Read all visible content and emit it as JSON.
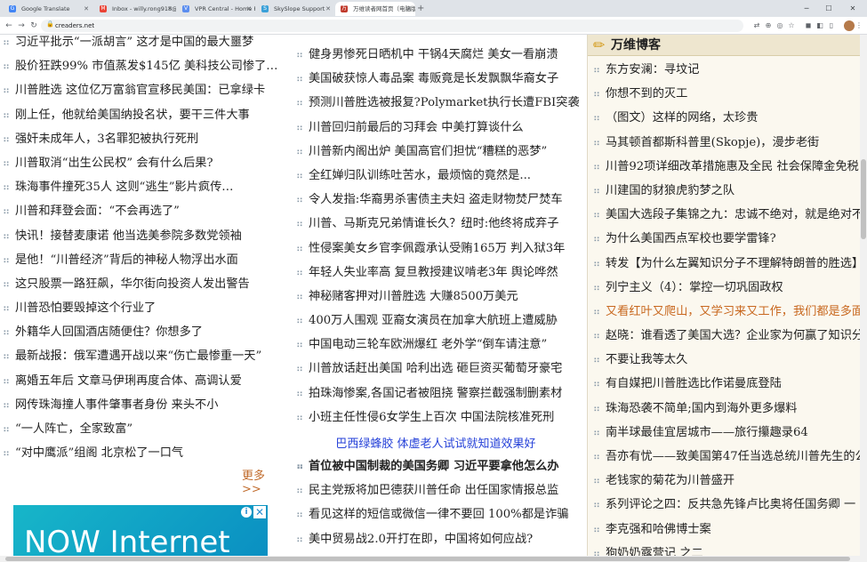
{
  "browser": {
    "tabs": [
      {
        "title": "Google Translate",
        "icon": "translate-icon",
        "color": "#4285f4"
      },
      {
        "title": "Inbox - willy.rong918@gmail.c...",
        "icon": "gmail-icon",
        "color": "#ea4335"
      },
      {
        "title": "VPR Central - Home Page",
        "icon": "page-icon",
        "color": "#5b8def"
      },
      {
        "title": "SkySlope Support",
        "icon": "support-icon",
        "color": "#3aa0d8"
      },
      {
        "title": "万维读者网首页（电脑版）",
        "icon": "site-icon",
        "color": "#c0392b"
      }
    ],
    "url": "creaders.net"
  },
  "left_column": {
    "headlines": [
      "习近平批示“一派胡言” 这才是中国的最大噩梦",
      "股价狂跌99% 市值蒸发$145亿 美科技公司惨了…",
      "川普胜选 这位亿万富翁官宣移民美国：已拿绿卡",
      "刚上任，他就给美国纳投名状，要干三件大事",
      "强奸未成年人，3名罪犯被执行死刑",
      "川普取消“出生公民权” 会有什么后果?",
      "珠海事件撞死35人 这则“逃生”影片疯传…",
      "川普和拜登会面：“不会再选了”",
      "快讯！接替麦康诺 他当选美参院多数党领袖",
      "是他！“川普经济”背后的神秘人物浮出水面",
      "这只股票一路狂飙，华尔街向投资人发出警告",
      "川普恐怕要毁掉这个行业了",
      "外籍华人回国酒店随便住？你想多了",
      "最新战报：俄军遭遇开战以来“伤亡最惨重一天”",
      "离婚五年后 文章马伊琍再度合体、高调认爱",
      "网传珠海撞人事件肇事者身份 来头不小",
      "“一人阵亡，全家致富”",
      "“对中鹰派”组阁 北京松了一口气"
    ],
    "more_label": "更多>>",
    "ad": {
      "text": "NOW Internet",
      "info": "i",
      "close": "✕"
    }
  },
  "middle_column": {
    "headlines": [
      "健身男惨死日晒机中 干锅4天腐烂 美女一看崩溃",
      "美国破获惊人毒品案 毒贩竟是长发飘飘华裔女子",
      "预测川普胜选被报复?Polymarket执行长遭FBI突袭",
      "川普回归前最后的习拜会 中美打算谈什么",
      "川普新内阁出炉 美国高官们担忧“糟糕的恶梦”",
      "全红婵归队训练吐苦水，最烦恼的竟然是...",
      "令人发指:华裔男杀害债主夫妇 盗走财物焚尸焚车",
      "川普、马斯克兄弟情谁长久？纽时:他终将成弃子",
      "性侵案美女乡官李佩霞承认受贿165万 判入狱3年",
      "年轻人失业率高 复旦教授建议啃老3年 舆论哗然",
      "神秘赌客押对川普胜选 大赚8500万美元",
      "400万人围观 亚裔女演员在加拿大航班上遭威胁",
      "中国电动三轮车欧洲爆红 老外学“倒车请注意”",
      "川普放话赶出美国 哈利出选 砸巨资买葡萄牙豪宅",
      "拍珠海惨案,各国记者被阻挠 警察拦截强制删素材",
      "小班主任性侵6女学生上百次 中国法院核准死刑"
    ],
    "ad_link": "巴西绿蜂胶 体虚老人试试就知道效果好",
    "headlines2": [
      "首位被中国制裁的美国务卿 习近平要拿他怎么办",
      "民主党叛将加巴德获川普任命 出任国家情报总监",
      "看见这样的短信或微信一律不要回 100%都是诈骗",
      "美中贸易战2.0开打在即，中国将如何应战?"
    ]
  },
  "right_column": {
    "title": "万维博客",
    "posts": [
      "东方安澜：寻坟记",
      "你想不到的灭工",
      "（图文）这样的网络，太珍贵",
      "马其顿首都斯科普里(Skopje)，漫步老街",
      "川普92项详细改革措施惠及全民 社会保障金免税",
      "川建国的豺狼虎豹梦之队",
      "美国大选段子集锦之九：忠诚不绝对，就是绝对不",
      "为什么美国西点军校也要学雷锋?",
      "转发【为什么左翼知识分子不理解特朗普的胜选】",
      "列宁主义（4）：掌控一切巩固政权",
      "又看红叶又爬山，又学习来又工作，我们都是多面",
      "赵晓：谁看透了美国大选？企业家为何赢了知识分",
      "不要让我等太久",
      "有自媒把川普胜选比作诺曼底登陆",
      "珠海恐袭不简单;国内到海外更多爆料",
      "南半球最佳宜居城市——旅行攥趣录64",
      "吾亦有忧——致美国第47任当选总统川普先生的公",
      "老钱家的菊花为川普盛开",
      "系列评论之四：反共急先锋卢比奥将任国务卿 一",
      "李克强和哈佛博士案",
      "狗奶奶露营记 之二"
    ],
    "highlight_index": 10,
    "highlight_color": "#c8681f"
  }
}
